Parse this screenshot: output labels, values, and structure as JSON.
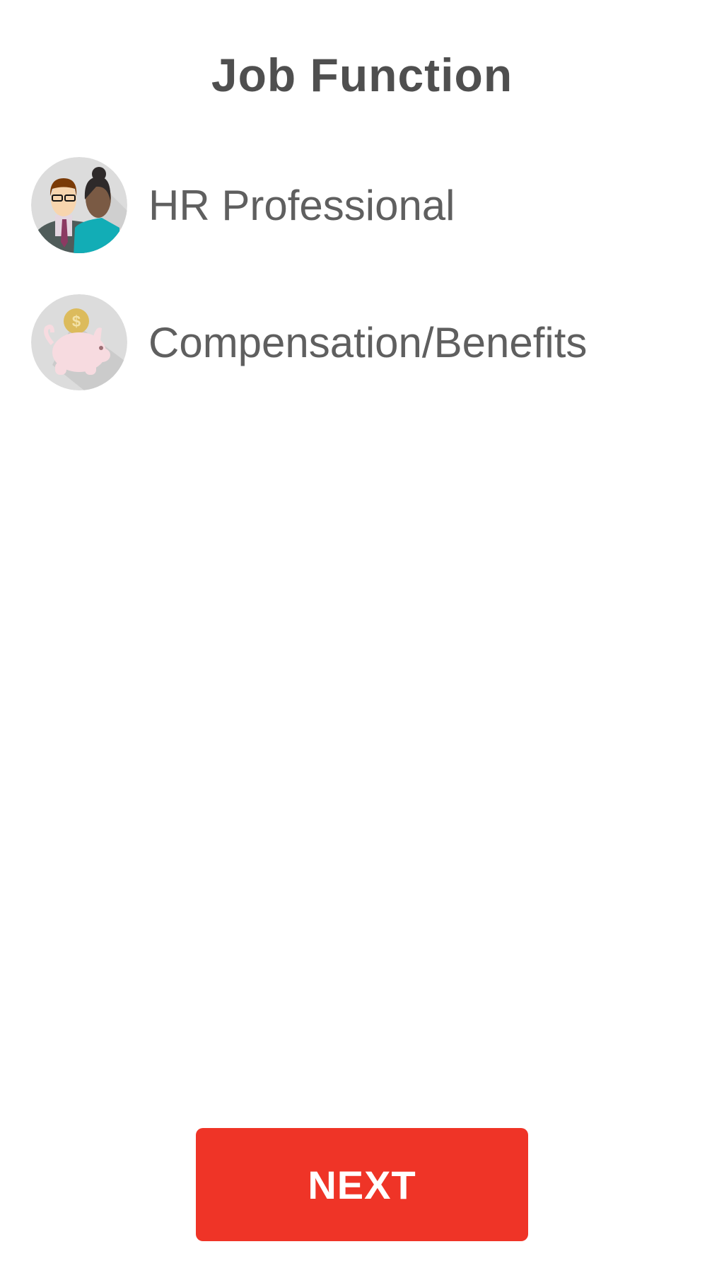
{
  "header": {
    "title": "Job Function"
  },
  "options": [
    {
      "label": "HR Professional",
      "icon": "people-icon"
    },
    {
      "label": "Compensation/Benefits",
      "icon": "piggy-bank-icon"
    }
  ],
  "footer": {
    "next_label": "NEXT"
  },
  "colors": {
    "accent": "#ef3427",
    "text": "#5f5f5f",
    "icon_bg": "#dcdcdc"
  }
}
